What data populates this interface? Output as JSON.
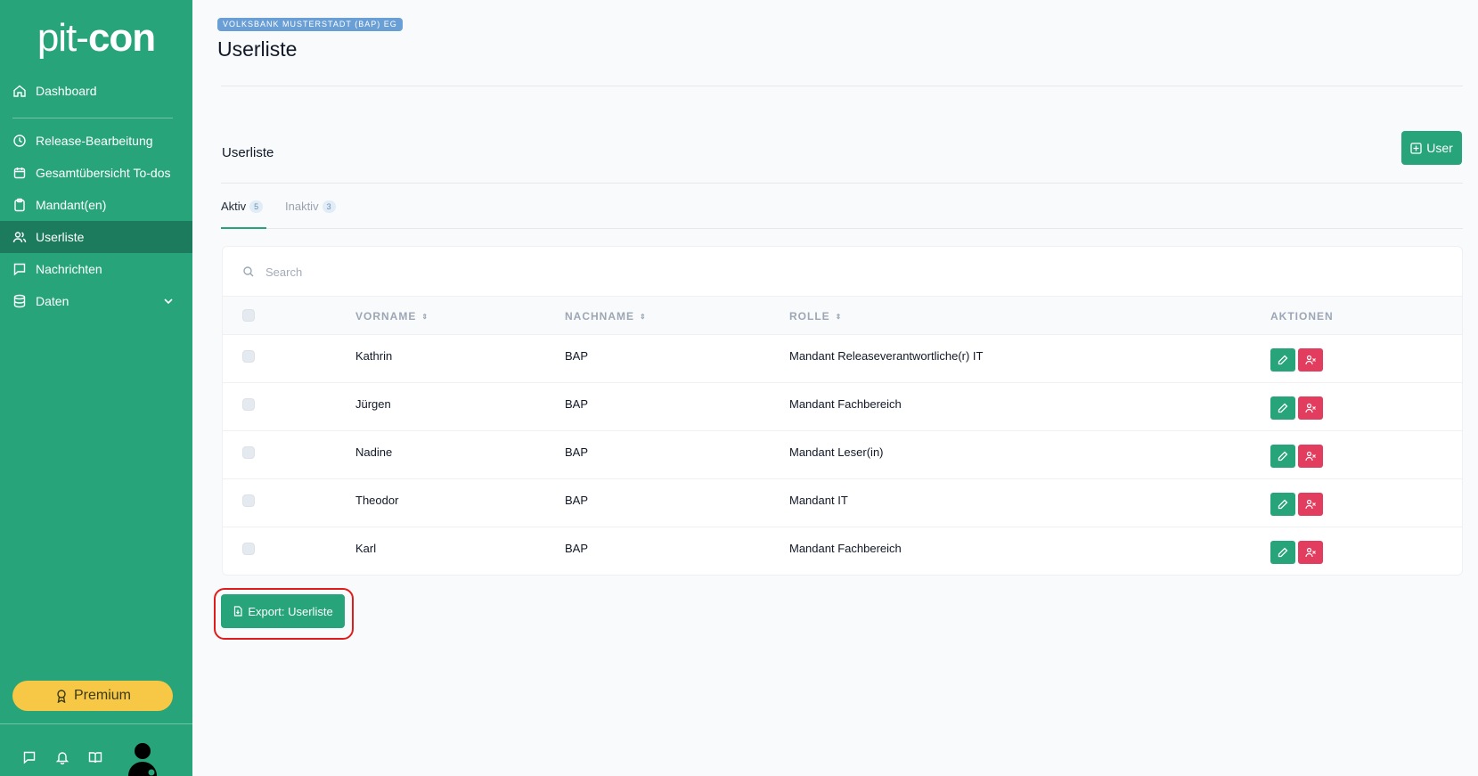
{
  "sidebar": {
    "logo_light": "pit-",
    "logo_bold": "con",
    "items": [
      {
        "label": "Dashboard",
        "icon": "home-icon"
      },
      {
        "label": "Release-Bearbeitung",
        "icon": "clock-icon"
      },
      {
        "label": "Gesamtübersicht To-dos",
        "icon": "calendar-icon"
      },
      {
        "label": "Mandant(en)",
        "icon": "clipboard-icon"
      },
      {
        "label": "Userliste",
        "icon": "users-icon",
        "active": true
      },
      {
        "label": "Nachrichten",
        "icon": "message-icon"
      },
      {
        "label": "Daten",
        "icon": "database-icon"
      }
    ],
    "premium_label": "Premium"
  },
  "header": {
    "bank_badge": "VOLKSBANK MUSTERSTADT (BAP) EG",
    "title": "Userliste"
  },
  "section": {
    "title": "Userliste",
    "add_user_label": "User"
  },
  "tabs": [
    {
      "label": "Aktiv",
      "count": "5"
    },
    {
      "label": "Inaktiv",
      "count": "3"
    }
  ],
  "search": {
    "placeholder": "Search"
  },
  "table": {
    "headers": [
      "VORNAME",
      "NACHNAME",
      "ROLLE",
      "AKTIONEN"
    ],
    "sort_glyph": "⇕",
    "rows": [
      {
        "vorname": "Kathrin",
        "nachname": "BAP",
        "rolle": "Mandant Releaseverantwortliche(r) IT"
      },
      {
        "vorname": "Jürgen",
        "nachname": "BAP",
        "rolle": "Mandant Fachbereich"
      },
      {
        "vorname": "Nadine",
        "nachname": "BAP",
        "rolle": "Mandant Leser(in)"
      },
      {
        "vorname": "Theodor",
        "nachname": "BAP",
        "rolle": "Mandant IT"
      },
      {
        "vorname": "Karl",
        "nachname": "BAP",
        "rolle": "Mandant Fachbereich"
      }
    ]
  },
  "export_label": "Export: Userliste",
  "colors": {
    "brand": "#28a47b",
    "brand_dark": "#1c7b5c",
    "danger": "#e23d5e",
    "premium": "#f7c845",
    "highlight": "#e01b1b"
  }
}
